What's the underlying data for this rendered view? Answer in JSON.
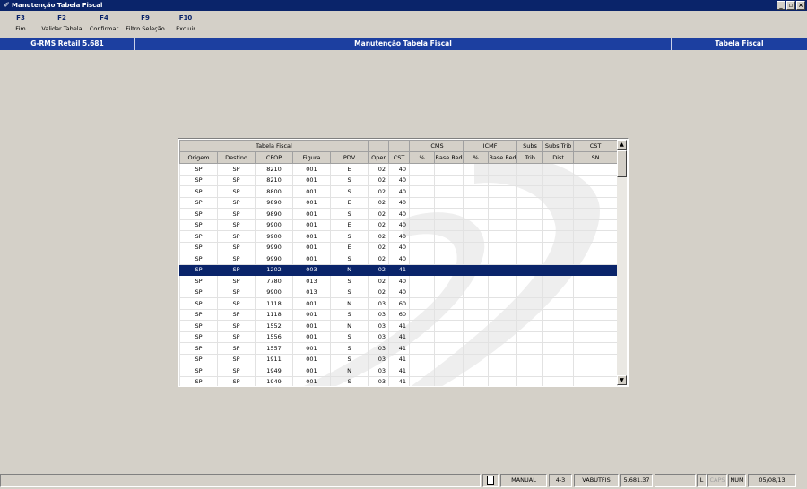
{
  "window": {
    "title": "Manutenção Tabela Fiscal",
    "minimize_glyph": "_",
    "restore_glyph": "▫",
    "close_glyph": "×"
  },
  "fkeys": [
    {
      "key": "F3",
      "label": "Fim"
    },
    {
      "key": "F2",
      "label": "Validar Tabela"
    },
    {
      "key": "F4",
      "label": "Confirmar"
    },
    {
      "key": "F9",
      "label": "Filtro Seleção"
    },
    {
      "key": "F10",
      "label": "Excluir"
    }
  ],
  "header": {
    "left": "G-RMS Retail 5.681",
    "center": "Manutenção Tabela Fiscal",
    "right": "Tabela Fiscal"
  },
  "grid": {
    "group_headers": {
      "tabela_fiscal": "Tabela Fiscal",
      "icms": "ICMS",
      "icmf": "ICMF",
      "subs": "Subs",
      "subs_trib": "Subs Trib",
      "cst": "CST"
    },
    "columns": [
      "Origem",
      "Destino",
      "CFOP",
      "Figura",
      "PDV",
      "Oper",
      "CST",
      "%",
      "Base Red",
      "%",
      "Base Red",
      "Trib",
      "Dist",
      "SN"
    ],
    "rows": [
      [
        "SP",
        "SP",
        "8210",
        "001",
        "E",
        "02",
        "40"
      ],
      [
        "SP",
        "SP",
        "8210",
        "001",
        "S",
        "02",
        "40"
      ],
      [
        "SP",
        "SP",
        "8800",
        "001",
        "S",
        "02",
        "40"
      ],
      [
        "SP",
        "SP",
        "9890",
        "001",
        "E",
        "02",
        "40"
      ],
      [
        "SP",
        "SP",
        "9890",
        "001",
        "S",
        "02",
        "40"
      ],
      [
        "SP",
        "SP",
        "9900",
        "001",
        "E",
        "02",
        "40"
      ],
      [
        "SP",
        "SP",
        "9900",
        "001",
        "S",
        "02",
        "40"
      ],
      [
        "SP",
        "SP",
        "9990",
        "001",
        "E",
        "02",
        "40"
      ],
      [
        "SP",
        "SP",
        "9990",
        "001",
        "S",
        "02",
        "40"
      ],
      [
        "SP",
        "SP",
        "1202",
        "003",
        "N",
        "02",
        "41"
      ],
      [
        "SP",
        "SP",
        "7780",
        "013",
        "S",
        "02",
        "40"
      ],
      [
        "SP",
        "SP",
        "9900",
        "013",
        "S",
        "02",
        "40"
      ],
      [
        "SP",
        "SP",
        "1118",
        "001",
        "N",
        "03",
        "60"
      ],
      [
        "SP",
        "SP",
        "1118",
        "001",
        "S",
        "03",
        "60"
      ],
      [
        "SP",
        "SP",
        "1552",
        "001",
        "N",
        "03",
        "41"
      ],
      [
        "SP",
        "SP",
        "1556",
        "001",
        "S",
        "03",
        "41"
      ],
      [
        "SP",
        "SP",
        "1557",
        "001",
        "S",
        "03",
        "41"
      ],
      [
        "SP",
        "SP",
        "1911",
        "001",
        "S",
        "03",
        "41"
      ],
      [
        "SP",
        "SP",
        "1949",
        "001",
        "N",
        "03",
        "41"
      ],
      [
        "SP",
        "SP",
        "1949",
        "001",
        "S",
        "03",
        "41"
      ]
    ],
    "selected_row": 9
  },
  "status": {
    "mode": "MANUAL",
    "code": "4-3",
    "user": "VABUTFIS",
    "version": "5.681.37",
    "l": "L",
    "caps": "CAPS",
    "num": "NUM",
    "date": "05/08/13"
  },
  "colors": {
    "title_bar": "#0a246a",
    "header_bar": "#1c3fa0",
    "selection": "#0a246a",
    "fkey": "#0a246a"
  }
}
